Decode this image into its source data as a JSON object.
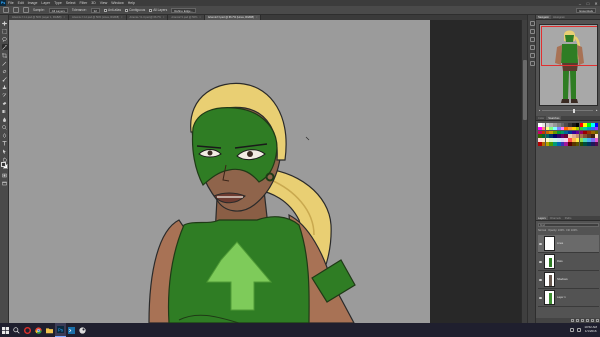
{
  "app": {
    "logo_text": "Ps",
    "menu": [
      "File",
      "Edit",
      "Image",
      "Layer",
      "Type",
      "Select",
      "Filter",
      "3D",
      "View",
      "Window",
      "Help"
    ],
    "window_controls": [
      "–",
      "□",
      "✕"
    ]
  },
  "options_bar": {
    "sample_label": "Sample:",
    "sample_value": "All Layers",
    "tolerance_label": "Tolerance:",
    "tolerance_value": "32",
    "anti_alias_label": "Anti-alias",
    "contiguous_label": "Contiguous",
    "all_layers_label": "All Layers",
    "refine_edge_label": "Refine Edge...",
    "workspace": "Essentials"
  },
  "doc_tabs": [
    {
      "label": "Artemis-YJ-1.psd @ 50% (Layer 1, RGB/8)",
      "active": false
    },
    {
      "label": "Artemis-YJ-2.psd @ 50% (Lines, RGB/8)",
      "active": false
    },
    {
      "label": "Artemis-YJ-3.psd @ 66.7%",
      "active": false
    },
    {
      "label": "ArtemisYJ.psd @ 50%",
      "active": false
    },
    {
      "label": "ArtemisYJ.psd @ 66.7% (Lines, RGB/8)",
      "active": true
    }
  ],
  "right_panels": {
    "navigator_tabs": [
      "Navigator",
      "Histogram"
    ],
    "swatch_tabs": [
      "Color",
      "Swatches"
    ],
    "layers_tabs": [
      "Layers",
      "Channels",
      "Paths"
    ],
    "layer_filter": "Kind",
    "layer_mode": "Normal",
    "opacity_label": "Opacity: 100%",
    "fill_label": "Fill: 100%",
    "layers": [
      {
        "name": "Lines",
        "selected": true
      },
      {
        "name": "Flats",
        "selected": false
      },
      {
        "name": "Shadows",
        "selected": false
      },
      {
        "name": "Layer 1",
        "selected": false
      },
      {
        "name": "Background",
        "selected": false
      }
    ]
  },
  "swatch_colors": [
    "#ffffff",
    "#e6e6e6",
    "#cccccc",
    "#b3b3b3",
    "#999999",
    "#808080",
    "#666666",
    "#4d4d4d",
    "#333333",
    "#1a1a1a",
    "#000000",
    "#ff0000",
    "#ffff00",
    "#00ff00",
    "#00ffff",
    "#0000ff",
    "#ff00ff",
    "#ff8080",
    "#ffff80",
    "#80ff80",
    "#80ffff",
    "#8080ff",
    "#ff80ff",
    "#ff6600",
    "#ff9933",
    "#ffcc00",
    "#99cc00",
    "#33cc33",
    "#00cc99",
    "#0099cc",
    "#3366ff",
    "#9933ff",
    "#cc0066",
    "#cc3300",
    "#cc6600",
    "#cc9900",
    "#669900",
    "#009933",
    "#009966",
    "#006699",
    "#003399",
    "#330099",
    "#660099",
    "#990066",
    "#990000",
    "#993300",
    "#996600",
    "#666600",
    "#336600",
    "#006633",
    "#006666",
    "#003366",
    "#000066",
    "#330066",
    "#660066",
    "#660033",
    "#f2d0b0",
    "#e0b090",
    "#c89070",
    "#a87050",
    "#885030",
    "#603820",
    "#402010",
    "#ffe0c0",
    "#ffd7d7",
    "#ffe9c9",
    "#fffbcc",
    "#dcf7cc",
    "#ccf5ee",
    "#cce7fb",
    "#d8d4f5",
    "#f3d3ef",
    "#ff4d4d",
    "#ffb84d",
    "#fff04d",
    "#8fe04d",
    "#4dd9c0",
    "#4db0f0",
    "#7a6ff0",
    "#e05ad0",
    "#b30000",
    "#b36b00",
    "#b3a300",
    "#4d9900",
    "#00997a",
    "#0066b3",
    "#3f2fb3",
    "#a0189a",
    "#590000",
    "#5a3600",
    "#5a5200",
    "#264d00",
    "#004d3d",
    "#00335a",
    "#1f175a",
    "#50094d"
  ],
  "taskbar": {
    "items": [
      "start",
      "search",
      "file-explorer",
      "chrome",
      "task-view",
      "photoshop",
      "terminal",
      "steam"
    ],
    "time": "10:52 AM",
    "date": "1/1/2016"
  }
}
